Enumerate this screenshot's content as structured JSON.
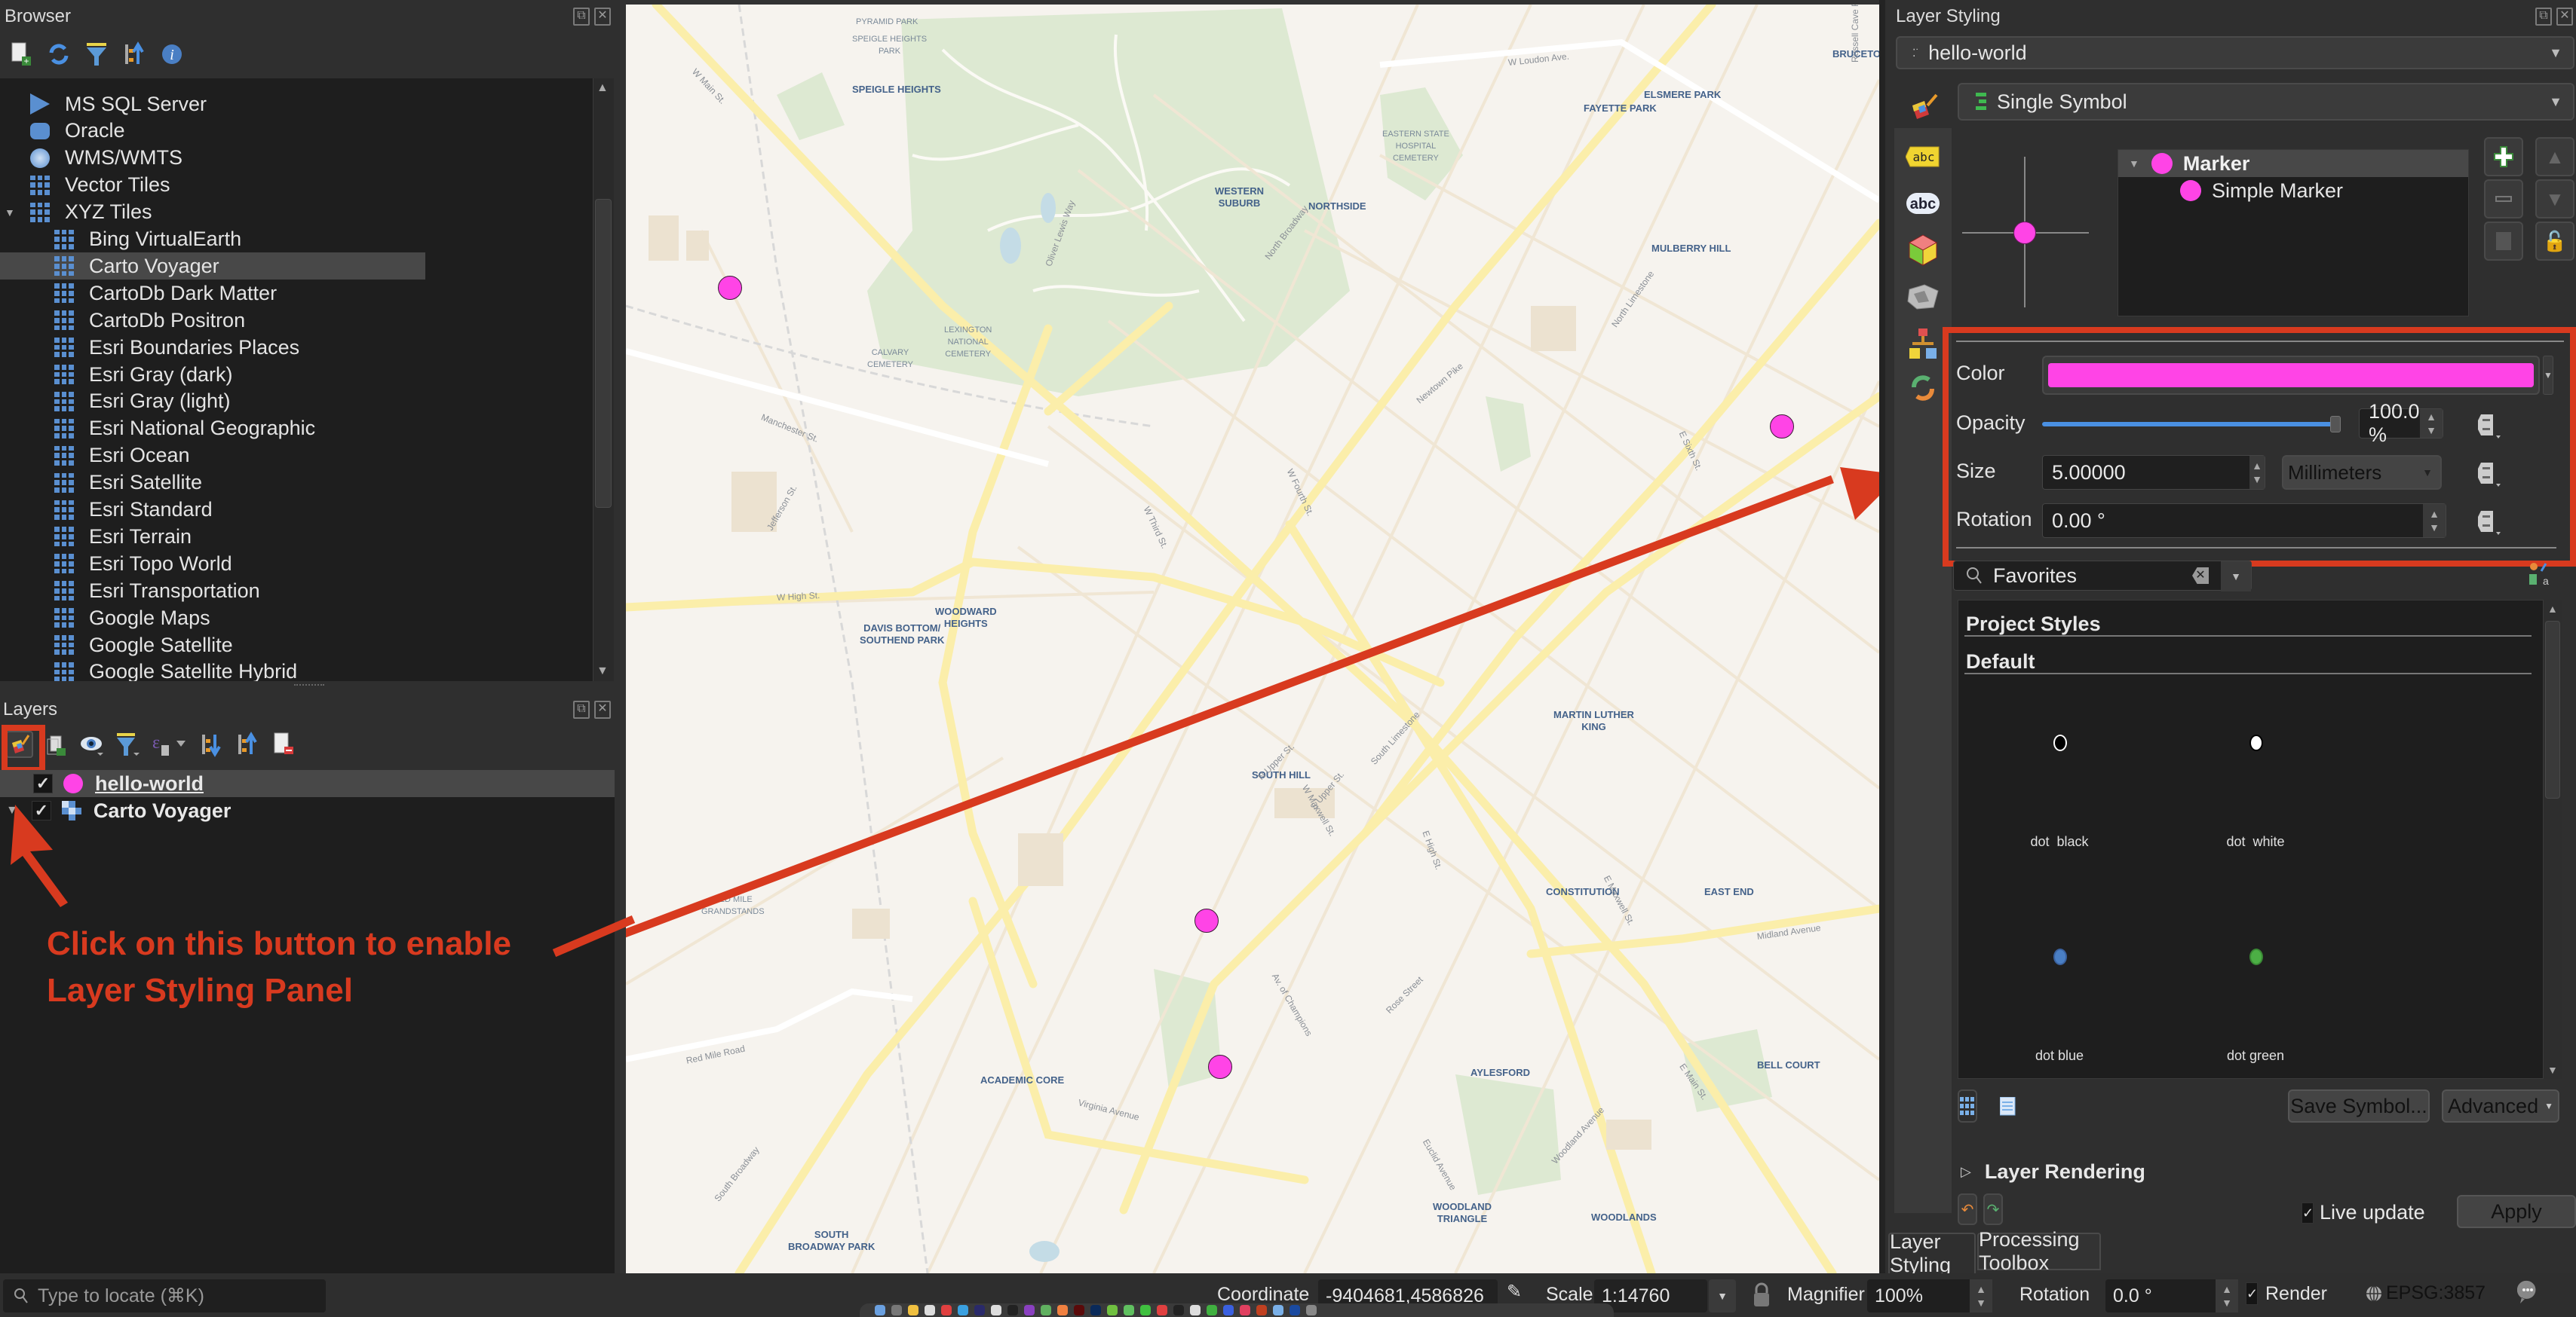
{
  "browser": {
    "title": "Browser",
    "toolbar": [
      "add-layer-icon",
      "refresh-icon",
      "filter-icon",
      "collapse-all-icon",
      "info-icon"
    ],
    "items": [
      {
        "label": "MS SQL Server",
        "icon": "mssql-icon",
        "indent": 0
      },
      {
        "label": "Oracle",
        "icon": "oracle-icon",
        "indent": 0
      },
      {
        "label": "WMS/WMTS",
        "icon": "wms-globe-icon",
        "indent": 0
      },
      {
        "label": "Vector Tiles",
        "icon": "grid-icon",
        "indent": 0
      },
      {
        "label": "XYZ Tiles",
        "icon": "grid-icon",
        "indent": 0,
        "expanded": true
      },
      {
        "label": "Bing VirtualEarth",
        "icon": "grid-icon",
        "indent": 1
      },
      {
        "label": "Carto Voyager",
        "icon": "grid-icon",
        "indent": 1,
        "selected": true
      },
      {
        "label": "CartoDb Dark Matter",
        "icon": "grid-icon",
        "indent": 1
      },
      {
        "label": "CartoDb Positron",
        "icon": "grid-icon",
        "indent": 1
      },
      {
        "label": "Esri Boundaries Places",
        "icon": "grid-icon",
        "indent": 1
      },
      {
        "label": "Esri Gray (dark)",
        "icon": "grid-icon",
        "indent": 1
      },
      {
        "label": "Esri Gray (light)",
        "icon": "grid-icon",
        "indent": 1
      },
      {
        "label": "Esri National Geographic",
        "icon": "grid-icon",
        "indent": 1
      },
      {
        "label": "Esri Ocean",
        "icon": "grid-icon",
        "indent": 1
      },
      {
        "label": "Esri Satellite",
        "icon": "grid-icon",
        "indent": 1
      },
      {
        "label": "Esri Standard",
        "icon": "grid-icon",
        "indent": 1
      },
      {
        "label": "Esri Terrain",
        "icon": "grid-icon",
        "indent": 1
      },
      {
        "label": "Esri Topo World",
        "icon": "grid-icon",
        "indent": 1
      },
      {
        "label": "Esri Transportation",
        "icon": "grid-icon",
        "indent": 1
      },
      {
        "label": "Google Maps",
        "icon": "grid-icon",
        "indent": 1
      },
      {
        "label": "Google Satellite",
        "icon": "grid-icon",
        "indent": 1
      },
      {
        "label": "Google Satellite Hybrid",
        "icon": "grid-icon",
        "indent": 1
      }
    ]
  },
  "layers": {
    "title": "Layers",
    "toolbar": [
      "layer-styling-icon",
      "add-group-icon",
      "visibility-icon",
      "filter-legend-icon",
      "filter-expression-icon",
      "expand-all-icon",
      "collapse-all-icon",
      "remove-layer-icon"
    ],
    "items": [
      {
        "label": "hello-world",
        "checked": true,
        "icon": "point-symbol-icon",
        "selected": true
      },
      {
        "label": "Carto Voyager",
        "checked": true,
        "icon": "raster-icon",
        "expandable": true
      }
    ]
  },
  "annotation": {
    "line1": "Click on this button to enable",
    "line2": "Layer Styling Panel",
    "color": "#d83a1f"
  },
  "map": {
    "neighborhoods": [
      {
        "label": "EASTERN STATE\nHOSPITAL\nCEMETERY",
        "small": true
      },
      {
        "label": "LEXINGTON\nNATIONAL\nCEMETERY",
        "small": true
      },
      {
        "label": "CALVARY\nCEMETERY",
        "small": true
      },
      {
        "label": "PYRAMID PARK",
        "small": true
      },
      {
        "label": "SPEIGLE HEIGHTS\nPARK",
        "small": true
      },
      {
        "label": "SPEIGLE HEIGHTS"
      },
      {
        "label": "WESTERN\nSUBURB"
      },
      {
        "label": "NORTHSIDE"
      },
      {
        "label": "FAYETTE PARK"
      },
      {
        "label": "ELSMERE PARK"
      },
      {
        "label": "BRUCETOWN"
      },
      {
        "label": "MULBERRY HILL"
      },
      {
        "label": "WOODWARD\nHEIGHTS"
      },
      {
        "label": "DAVIS BOTTOM/\nSOUTHEND PARK"
      },
      {
        "label": "CONSTITUTION"
      },
      {
        "label": "MARTIN LUTHER\nKING"
      },
      {
        "label": "SOUTH HILL"
      },
      {
        "label": "EAST END"
      },
      {
        "label": "RED MILE\nGRANDSTANDS",
        "small": true
      },
      {
        "label": "BELL COURT"
      },
      {
        "label": "AYLESFORD"
      },
      {
        "label": "ACADEMIC CORE"
      },
      {
        "label": "WOODLAND\nTRIANGLE"
      },
      {
        "label": "WOODLANDS"
      },
      {
        "label": "SOUTH\nBROADWAY PARK"
      }
    ],
    "streets": [
      "W Main St.",
      "W Loudon Ave.",
      "Manchester St.",
      "W High St.",
      "North Broadway",
      "South Broadway",
      "Oliver Lewis Way",
      "Newtown Pike",
      "South Limestone",
      "Virginia Avenue",
      "Red Mile Road",
      "Midland Avenue",
      "E Main St.",
      "W Maxwell St.",
      "E Maxwell St.",
      "N Upper St.",
      "S Upper St.",
      "E High St.",
      "Rose Street",
      "Euclid Avenue",
      "Jefferson St.",
      "W Fourth St.",
      "W Third St.",
      "North Limestone",
      "E Sixth St.",
      "Av. of Champions",
      "Woodland Avenue",
      "Russell Cave Rd"
    ],
    "markers": [
      {
        "name": "marker-1"
      },
      {
        "name": "marker-2"
      },
      {
        "name": "marker-3"
      },
      {
        "name": "marker-4"
      }
    ],
    "marker_color": "#ff44e6"
  },
  "styling": {
    "title": "Layer Styling",
    "layer_select": "hello-world",
    "renderer": "Single Symbol",
    "symbol_tree": {
      "root": "Marker",
      "child": "Simple Marker"
    },
    "color_label": "Color",
    "color_value": "#ff44e6",
    "opacity_label": "Opacity",
    "opacity_value": "100.0 %",
    "opacity_fraction": 1.0,
    "size_label": "Size",
    "size_value": "5.00000",
    "size_unit": "Millimeters",
    "rotation_label": "Rotation",
    "rotation_value": "0.00 °",
    "search_placeholder": "Favorites",
    "groups": [
      "Project Styles",
      "Default"
    ],
    "symbols": [
      {
        "label": "dot  black",
        "fill": "#000000",
        "stroke": "#ffffff"
      },
      {
        "label": "dot  white",
        "fill": "#ffffff",
        "stroke": "#000000"
      },
      {
        "label": "dot blue",
        "fill": "#4a7fc4",
        "stroke": "#3a62a0"
      },
      {
        "label": "dot green",
        "fill": "#4caf45",
        "stroke": "#3a8a35"
      }
    ],
    "save_symbol": "Save Symbol...",
    "advanced": "Advanced",
    "layer_rendering": "Layer Rendering",
    "live_update": "Live update",
    "live_update_checked": true,
    "apply": "Apply",
    "tabs": [
      "Layer Styling",
      "Processing Toolbox"
    ]
  },
  "status": {
    "locate_placeholder": "Type to locate (⌘K)",
    "coordinate_label": "Coordinate",
    "coordinate_value": "-9404681,4586826",
    "scale_label": "Scale",
    "scale_value": "1:14760",
    "magnifier_label": "Magnifier",
    "magnifier_value": "100%",
    "rotation_label": "Rotation",
    "rotation_value": "0.0 °",
    "render_label": "Render",
    "render_checked": true,
    "crs": "EPSG:3857"
  }
}
